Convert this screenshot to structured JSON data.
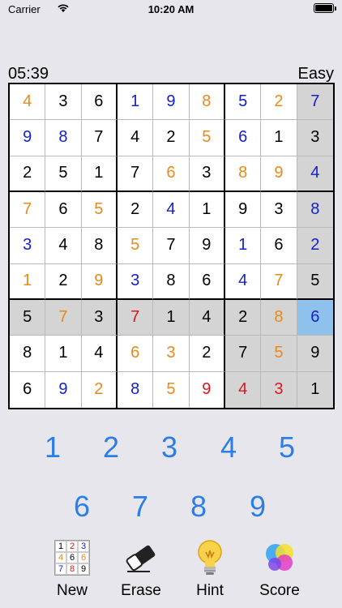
{
  "status_bar": {
    "carrier": "Carrier",
    "time": "10:20 AM"
  },
  "header": {
    "timer": "05:39",
    "difficulty": "Easy"
  },
  "colors": {
    "given": "#000000",
    "user_blue": "#1620c8",
    "user_orange": "#e8891a",
    "conflict_red": "#e0141e",
    "numpad": "#2b7de8",
    "highlight": "#d4d4d4",
    "selected": "#8ec2ec"
  },
  "board": {
    "selected_cell": [
      6,
      8
    ],
    "highlighted_cells": [
      [
        0,
        8
      ],
      [
        1,
        8
      ],
      [
        2,
        8
      ],
      [
        3,
        8
      ],
      [
        4,
        8
      ],
      [
        5,
        8
      ],
      [
        7,
        8
      ],
      [
        8,
        8
      ],
      [
        6,
        0
      ],
      [
        6,
        1
      ],
      [
        6,
        2
      ],
      [
        6,
        3
      ],
      [
        6,
        4
      ],
      [
        6,
        5
      ],
      [
        6,
        6
      ],
      [
        6,
        7
      ],
      [
        7,
        6
      ],
      [
        7,
        7
      ],
      [
        8,
        6
      ],
      [
        8,
        7
      ]
    ],
    "rows": [
      [
        {
          "v": "4",
          "c": "o"
        },
        {
          "v": "3",
          "c": "k"
        },
        {
          "v": "6",
          "c": "k"
        },
        {
          "v": "1",
          "c": "b"
        },
        {
          "v": "9",
          "c": "b"
        },
        {
          "v": "8",
          "c": "o"
        },
        {
          "v": "5",
          "c": "b"
        },
        {
          "v": "2",
          "c": "o"
        },
        {
          "v": "7",
          "c": "b"
        }
      ],
      [
        {
          "v": "9",
          "c": "b"
        },
        {
          "v": "8",
          "c": "b"
        },
        {
          "v": "7",
          "c": "k"
        },
        {
          "v": "4",
          "c": "k"
        },
        {
          "v": "2",
          "c": "k"
        },
        {
          "v": "5",
          "c": "o"
        },
        {
          "v": "6",
          "c": "b"
        },
        {
          "v": "1",
          "c": "k"
        },
        {
          "v": "3",
          "c": "k"
        }
      ],
      [
        {
          "v": "2",
          "c": "k"
        },
        {
          "v": "5",
          "c": "k"
        },
        {
          "v": "1",
          "c": "k"
        },
        {
          "v": "7",
          "c": "k"
        },
        {
          "v": "6",
          "c": "o"
        },
        {
          "v": "3",
          "c": "k"
        },
        {
          "v": "8",
          "c": "o"
        },
        {
          "v": "9",
          "c": "o"
        },
        {
          "v": "4",
          "c": "b"
        }
      ],
      [
        {
          "v": "7",
          "c": "o"
        },
        {
          "v": "6",
          "c": "k"
        },
        {
          "v": "5",
          "c": "o"
        },
        {
          "v": "2",
          "c": "k"
        },
        {
          "v": "4",
          "c": "b"
        },
        {
          "v": "1",
          "c": "k"
        },
        {
          "v": "9",
          "c": "k"
        },
        {
          "v": "3",
          "c": "k"
        },
        {
          "v": "8",
          "c": "b"
        }
      ],
      [
        {
          "v": "3",
          "c": "b"
        },
        {
          "v": "4",
          "c": "k"
        },
        {
          "v": "8",
          "c": "k"
        },
        {
          "v": "5",
          "c": "o"
        },
        {
          "v": "7",
          "c": "k"
        },
        {
          "v": "9",
          "c": "k"
        },
        {
          "v": "1",
          "c": "b"
        },
        {
          "v": "6",
          "c": "k"
        },
        {
          "v": "2",
          "c": "b"
        }
      ],
      [
        {
          "v": "1",
          "c": "o"
        },
        {
          "v": "2",
          "c": "k"
        },
        {
          "v": "9",
          "c": "o"
        },
        {
          "v": "3",
          "c": "b"
        },
        {
          "v": "8",
          "c": "k"
        },
        {
          "v": "6",
          "c": "k"
        },
        {
          "v": "4",
          "c": "b"
        },
        {
          "v": "7",
          "c": "o"
        },
        {
          "v": "5",
          "c": "k"
        }
      ],
      [
        {
          "v": "5",
          "c": "k"
        },
        {
          "v": "7",
          "c": "o"
        },
        {
          "v": "3",
          "c": "k"
        },
        {
          "v": "7",
          "c": "r"
        },
        {
          "v": "1",
          "c": "k"
        },
        {
          "v": "4",
          "c": "k"
        },
        {
          "v": "2",
          "c": "k"
        },
        {
          "v": "8",
          "c": "o"
        },
        {
          "v": "6",
          "c": "b"
        }
      ],
      [
        {
          "v": "8",
          "c": "k"
        },
        {
          "v": "1",
          "c": "k"
        },
        {
          "v": "4",
          "c": "k"
        },
        {
          "v": "6",
          "c": "o"
        },
        {
          "v": "3",
          "c": "o"
        },
        {
          "v": "2",
          "c": "k"
        },
        {
          "v": "7",
          "c": "k"
        },
        {
          "v": "5",
          "c": "o"
        },
        {
          "v": "9",
          "c": "k"
        }
      ],
      [
        {
          "v": "6",
          "c": "k"
        },
        {
          "v": "9",
          "c": "b"
        },
        {
          "v": "2",
          "c": "o"
        },
        {
          "v": "8",
          "c": "b"
        },
        {
          "v": "5",
          "c": "o"
        },
        {
          "v": "9",
          "c": "r"
        },
        {
          "v": "4",
          "c": "r"
        },
        {
          "v": "3",
          "c": "r"
        },
        {
          "v": "1",
          "c": "k"
        }
      ]
    ]
  },
  "numpad": [
    "1",
    "2",
    "3",
    "4",
    "5",
    "6",
    "7",
    "8",
    "9"
  ],
  "toolbar": {
    "new_label": "New",
    "new_icon_digits": [
      "1",
      "2",
      "3",
      "4",
      "6",
      "6",
      "7",
      "8",
      "9"
    ],
    "erase_label": "Erase",
    "hint_label": "Hint",
    "score_label": "Score"
  }
}
